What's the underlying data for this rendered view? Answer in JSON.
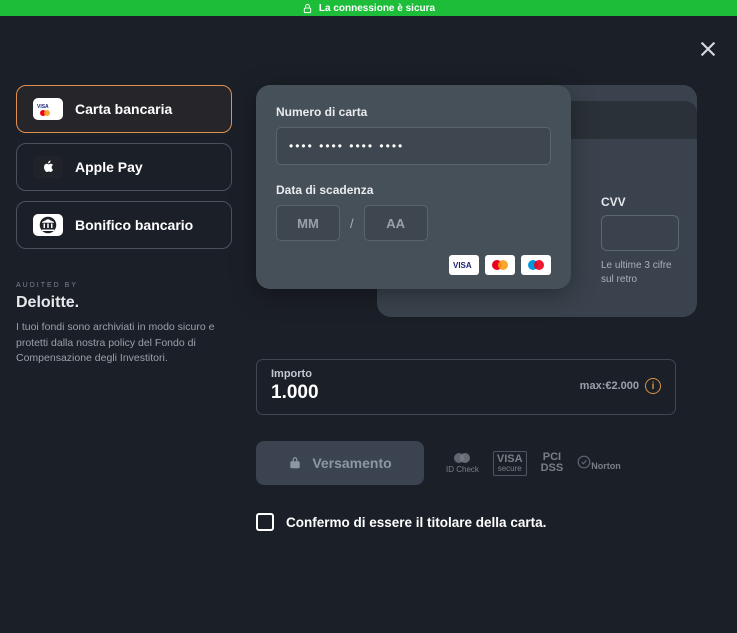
{
  "secure_bar": {
    "text": "La connessione è sicura"
  },
  "payment_methods": [
    {
      "label": "Carta bancaria",
      "selected": true
    },
    {
      "label": "Apple Pay",
      "selected": false
    },
    {
      "label": "Bonifico bancario",
      "selected": false
    }
  ],
  "audit": {
    "audited_by": "AUDITED BY",
    "auditor": "Deloitte.",
    "disclaimer": "I tuoi fondi sono archiviati in modo sicuro e protetti dalla nostra policy del Fondo di Compensazione degli Investitori."
  },
  "card_form": {
    "number_label": "Numero di carta",
    "number_value": "•••• •••• •••• ••••",
    "expiry_label": "Data di scadenza",
    "mm_placeholder": "MM",
    "yy_placeholder": "AA",
    "separator": "/",
    "cvv_label": "CVV",
    "cvv_hint": "Le ultime 3 cifre sul retro"
  },
  "amount": {
    "label": "Importo",
    "value": "1.000",
    "max_label": "max:€2.000"
  },
  "deposit_button": "Versamento",
  "certs": [
    "mastercard ID Check",
    "VISA secure",
    "PCI DSS",
    "Norton SECURED"
  ],
  "confirm": {
    "text": "Confermo di essere il titolare della carta."
  }
}
